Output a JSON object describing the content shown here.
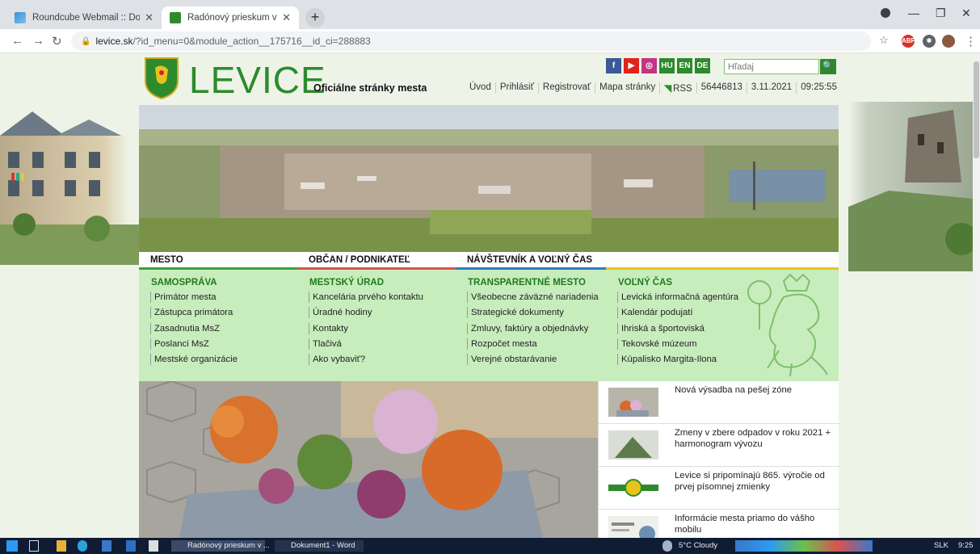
{
  "browser": {
    "tabs": [
      {
        "title": "Roundcube Webmail :: Doručená",
        "active": false
      },
      {
        "title": "Radónový prieskum v meste",
        "active": true
      }
    ],
    "new_tab": "+",
    "url_host": "levice.sk",
    "url_path": "/?id_menu=0&module_action__175716__id_ci=288883"
  },
  "site": {
    "logo_text": "LEVICE",
    "logo_sub": "Oficiálne stránky mesta",
    "social": [
      {
        "icon": "facebook-icon",
        "label": "f",
        "color": "#3b5998"
      },
      {
        "icon": "youtube-icon",
        "label": "▶",
        "color": "#e0241b"
      },
      {
        "icon": "instagram-icon",
        "label": "◎",
        "color": "#c13584"
      },
      {
        "icon": "lang-hu",
        "label": "HU",
        "color": "#2d8a2d"
      },
      {
        "icon": "lang-en",
        "label": "EN",
        "color": "#2d8a2d"
      },
      {
        "icon": "lang-de",
        "label": "DE",
        "color": "#2d8a2d"
      }
    ],
    "search_placeholder": "Hľadaj",
    "topnav": [
      "Úvod",
      "Prihlásiť",
      "Registrovať",
      "Mapa stránky"
    ],
    "rss": "RSS",
    "counter": "56446813",
    "date": "3.11.2021",
    "time": "09:25:55"
  },
  "mainnav": [
    {
      "label": "MESTO",
      "color": "#3aa23a"
    },
    {
      "label": "OBČAN / PODNIKATEĽ",
      "color": "#d9534f"
    },
    {
      "label": "NÁVŠTEVNÍK A VOĽNÝ ČAS",
      "color": "#2f7bc4"
    },
    {
      "label": "",
      "color": "#e9c21b"
    }
  ],
  "menu": [
    {
      "heading": "SAMOSPRÁVA",
      "items": [
        "Primátor mesta",
        "Zástupca primátora",
        "Zasadnutia MsZ",
        "Poslanci MsZ",
        "Mestské organizácie"
      ]
    },
    {
      "heading": "MESTSKÝ ÚRAD",
      "items": [
        "Kancelária prvého kontaktu",
        "Úradné hodiny",
        "Kontakty",
        "Tlačivá",
        "Ako vybaviť?"
      ]
    },
    {
      "heading": "TRANSPARENTNÉ MESTO",
      "items": [
        "Všeobecne záväzné nariadenia",
        "Strategické dokumenty",
        "Zmluvy, faktúry a objednávky",
        "Rozpočet mesta",
        "Verejné obstarávanie"
      ]
    },
    {
      "heading": "VOĽNÝ ČAS",
      "items": [
        "Levická informačná agentúra",
        "Kalendár podujatí",
        "Ihriská a športoviská",
        "Tekovské múzeum",
        "Kúpalisko Margita-Ilona"
      ]
    }
  ],
  "news": [
    "Nová výsadba na pešej zóne",
    "Zmeny v zbere odpadov v roku 2021 + harmonogram vývozu",
    "Levice si pripomínajú 865. výročie od prvej písomnej zmienky",
    "Informácie mesta priamo do vášho mobilu"
  ],
  "taskbar": {
    "apps": [
      "Radónový prieskum v ...",
      "Dokument1 - Word"
    ],
    "weather": "5°C Cloudy",
    "lang": "SLK",
    "clock": "9:25"
  }
}
